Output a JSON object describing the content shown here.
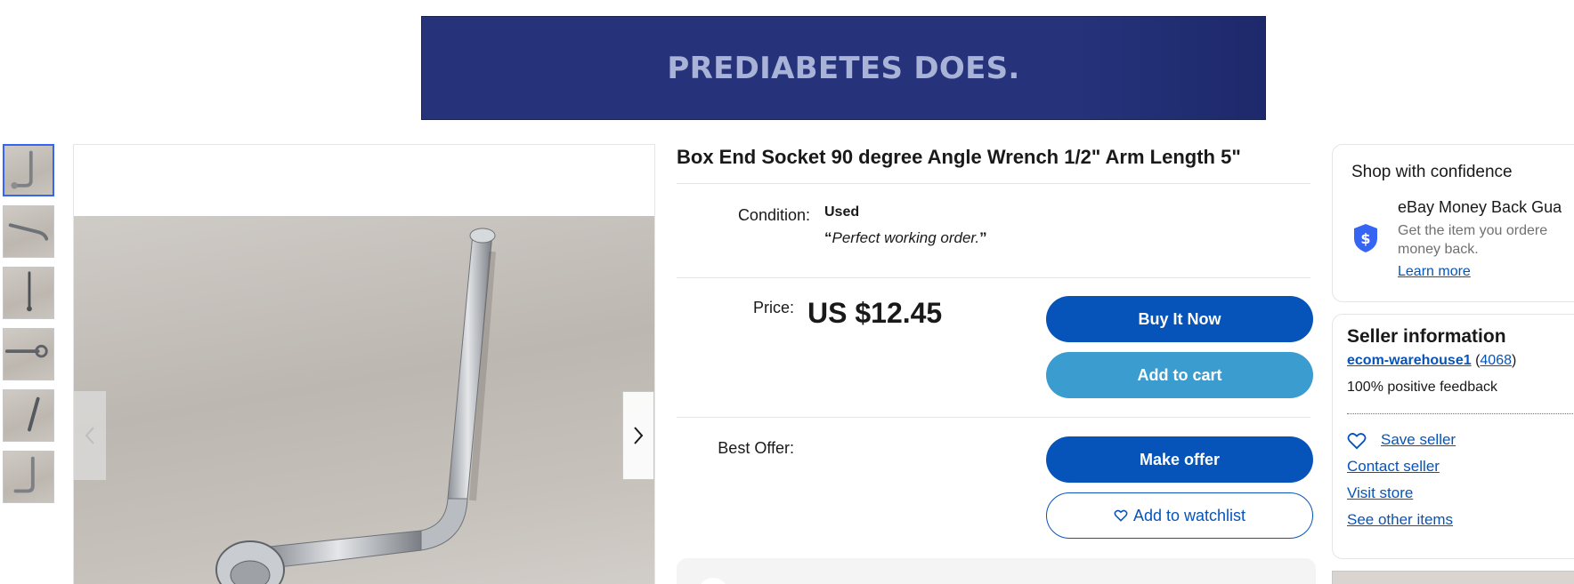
{
  "ad": {
    "text": "PREDIABETES DOES."
  },
  "listing": {
    "title": "Box End Socket 90 degree Angle Wrench 1/2\" Arm Length 5\"",
    "condition_label": "Condition:",
    "condition_value": "Used",
    "condition_note": "Perfect working order.",
    "condition_quote_open": "“",
    "condition_quote_close": "”",
    "price_label": "Price:",
    "price": "US $12.45",
    "best_offer_label": "Best Offer:"
  },
  "buttons": {
    "buy_now": "Buy It Now",
    "add_to_cart": "Add to cart",
    "make_offer": "Make offer",
    "add_to_watchlist": "Add to watchlist"
  },
  "gallery": {
    "thumbnail_count": 6,
    "active_index": 0,
    "prev_icon": "chevron-left-icon",
    "next_icon": "chevron-right-icon"
  },
  "confidence": {
    "title": "Shop with confidence",
    "item_title": "eBay Money Back Gua",
    "item_desc_1": "Get the item you ordere",
    "item_desc_2": "money back.",
    "learn_more": "Learn more",
    "icon": "shield-dollar-icon"
  },
  "seller": {
    "title": "Seller information",
    "name": "ecom-warehouse1",
    "open_paren": "(",
    "feedback_count": "4068",
    "close_paren": ")",
    "feedback": "100% positive feedback",
    "save_seller": "Save seller",
    "contact_seller": "Contact seller",
    "visit_store": "Visit store",
    "see_other_items": "See other items"
  },
  "colors": {
    "primary_blue": "#0654ba",
    "secondary_blue": "#3b9ccf",
    "ad_background": "#26337b"
  }
}
